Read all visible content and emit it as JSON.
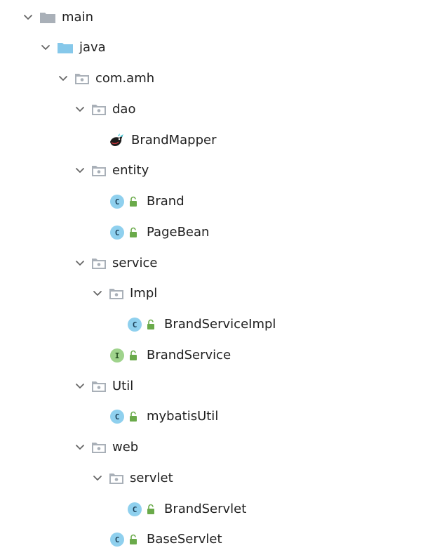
{
  "tree": {
    "items": [
      {
        "label": "main",
        "kind": "folder-gray",
        "expanded": true
      },
      {
        "label": "java",
        "kind": "folder-blue",
        "expanded": true
      },
      {
        "label": "com.amh",
        "kind": "package",
        "expanded": true
      },
      {
        "label": "dao",
        "kind": "package",
        "expanded": true
      },
      {
        "label": "BrandMapper",
        "kind": "mapper"
      },
      {
        "label": "entity",
        "kind": "package",
        "expanded": true
      },
      {
        "label": "Brand",
        "kind": "class"
      },
      {
        "label": "PageBean",
        "kind": "class"
      },
      {
        "label": "service",
        "kind": "package",
        "expanded": true
      },
      {
        "label": "Impl",
        "kind": "package",
        "expanded": true
      },
      {
        "label": "BrandServiceImpl",
        "kind": "class"
      },
      {
        "label": "BrandService",
        "kind": "interface"
      },
      {
        "label": "Util",
        "kind": "package",
        "expanded": true
      },
      {
        "label": "mybatisUtil",
        "kind": "class"
      },
      {
        "label": "web",
        "kind": "package",
        "expanded": true
      },
      {
        "label": "servlet",
        "kind": "package",
        "expanded": true
      },
      {
        "label": "BrandServlet",
        "kind": "class"
      },
      {
        "label": "BaseServlet",
        "kind": "class"
      }
    ]
  },
  "icons": {
    "chevron": "chevron-down-icon",
    "folder": "folder-icon",
    "package": "package-folder-icon",
    "class_badge": "C",
    "interface_badge": "I",
    "lock": "lock-open-icon",
    "mapper": "mybatis-bird-icon"
  },
  "colors": {
    "folder_gray": "#a9b0b8",
    "folder_blue": "#86c8ea",
    "class_badge": "#8fd0ee",
    "interface_badge": "#9fd38c",
    "lock": "#6aaa4a"
  }
}
